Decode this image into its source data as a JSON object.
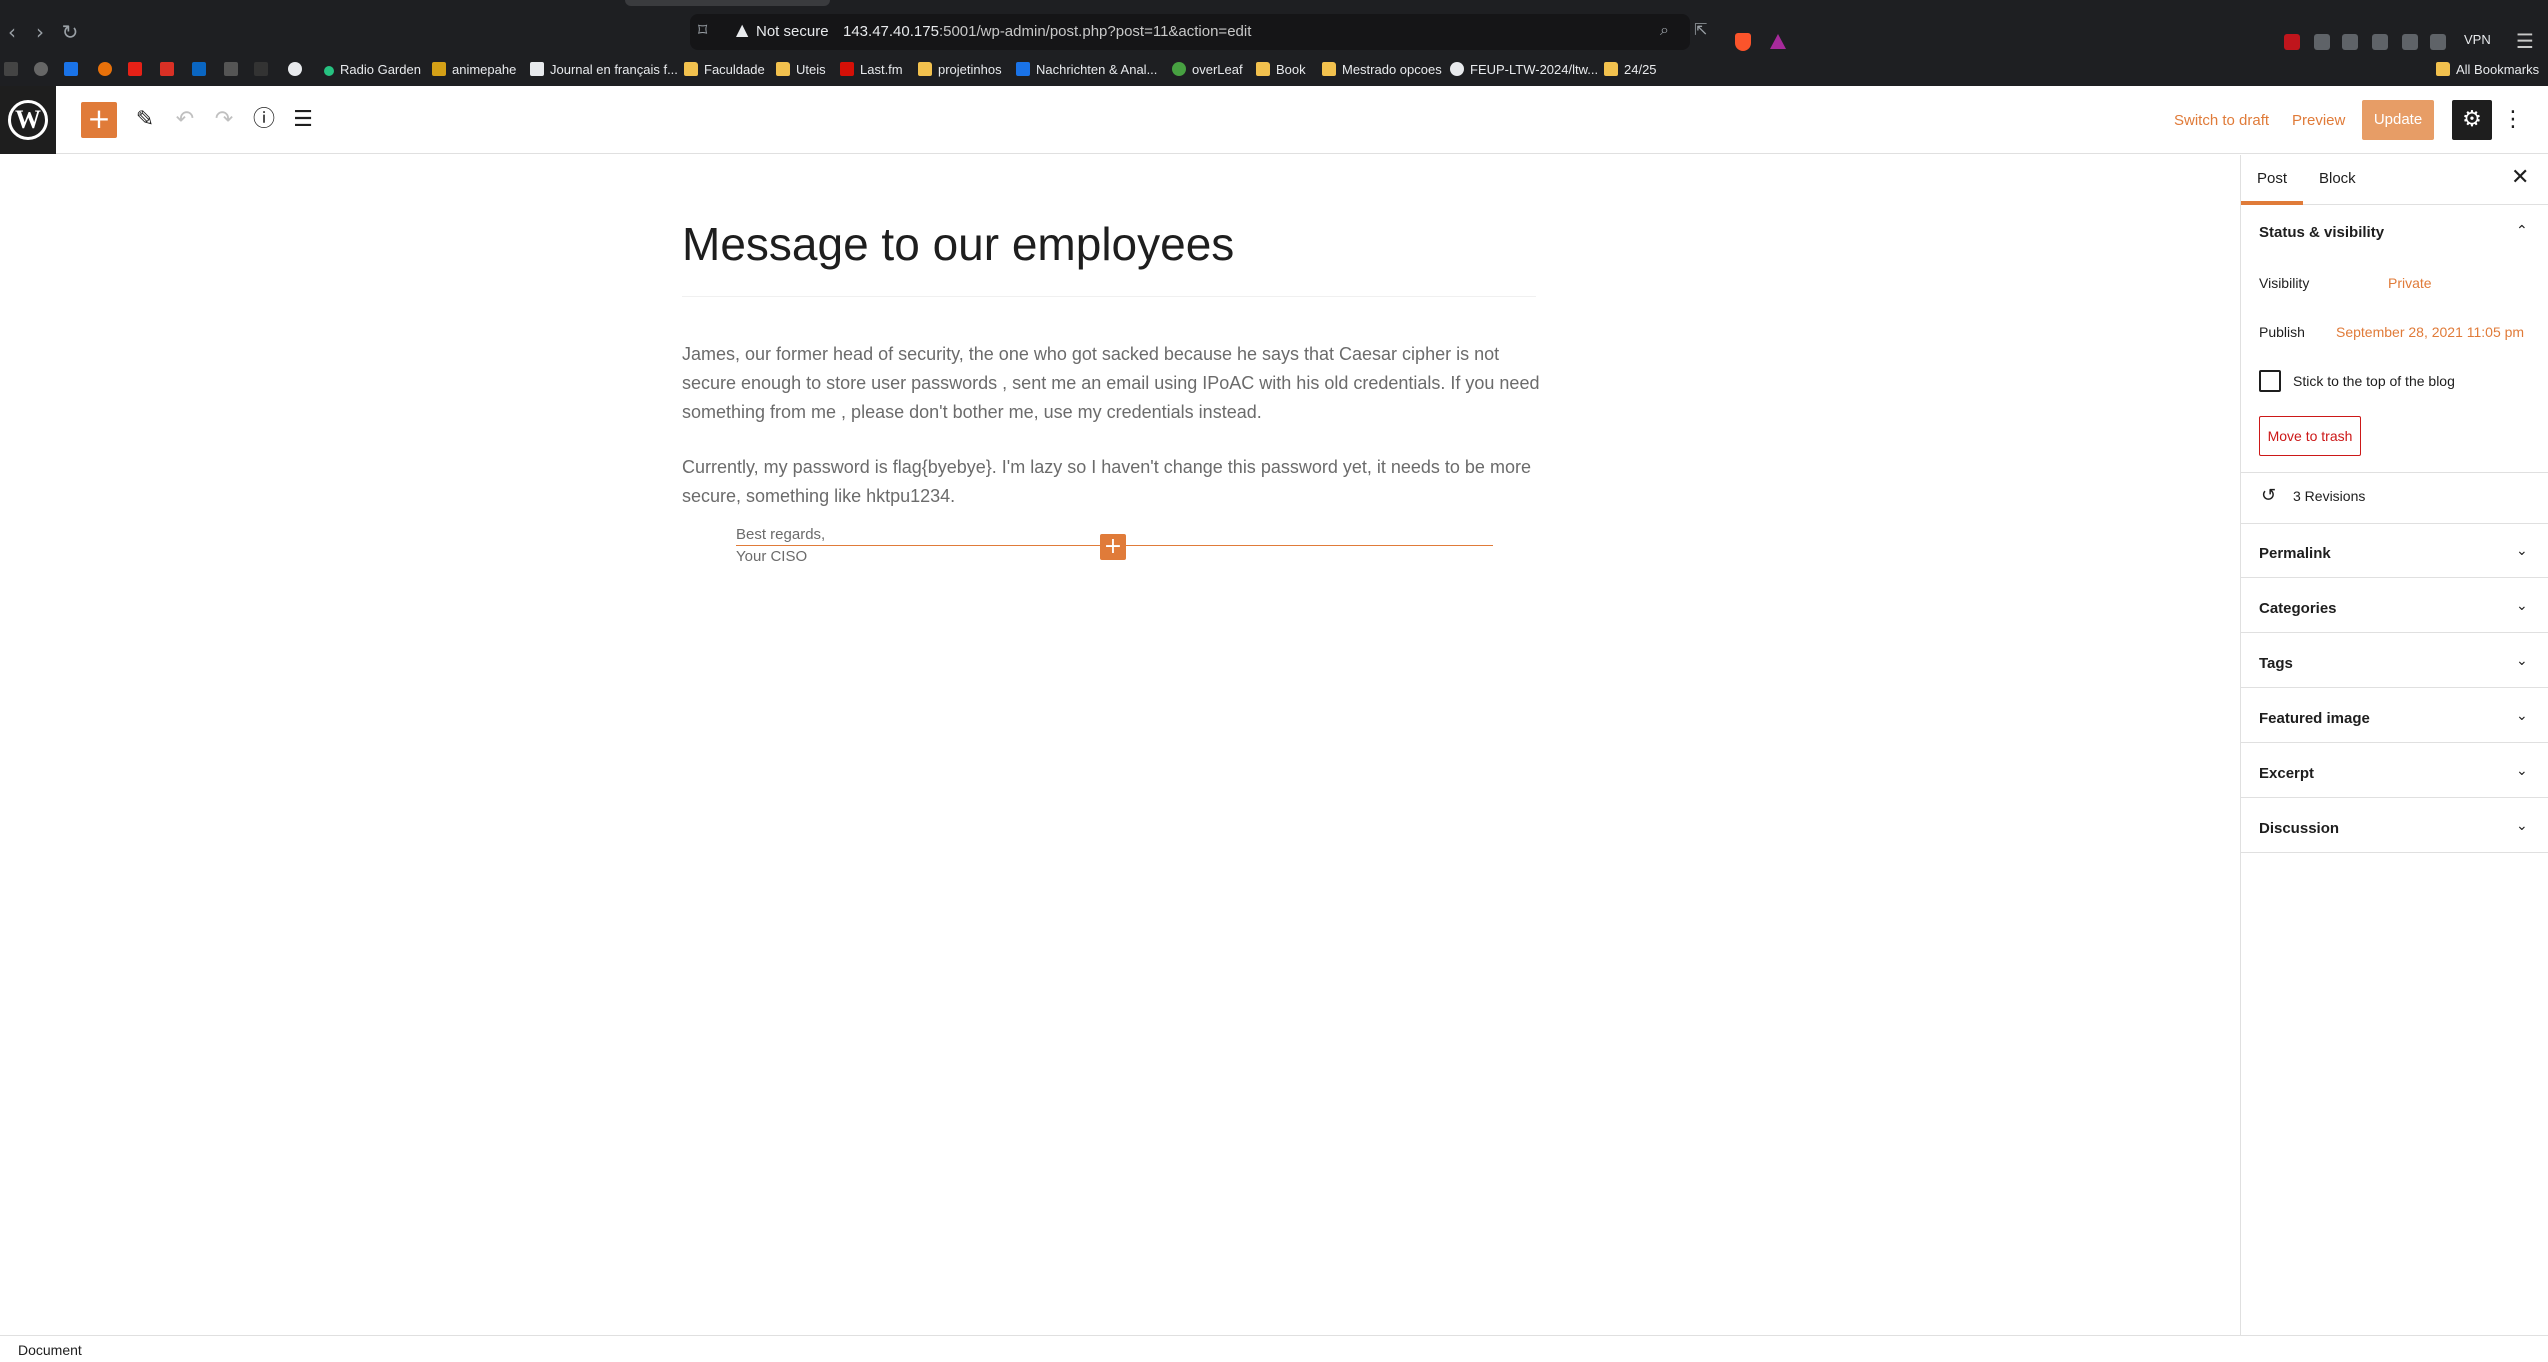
{
  "browser": {
    "security_label": "Not secure",
    "url_host": "143.47.40.175",
    "url_rest": ":5001/wp-admin/post.php?post=11&action=edit",
    "vpn_label": "VPN",
    "bookmarks": [
      "Radio Garden",
      "animepahe",
      "Journal en français f...",
      "Faculdade",
      "Uteis",
      "Last.fm",
      "projetinhos",
      "Nachrichten & Anal...",
      "overLeaf",
      "Book",
      "Mestrado opcoes",
      "FEUP-LTW-2024/ltw...",
      "24/25"
    ],
    "all_bookmarks": "All Bookmarks"
  },
  "toolbar": {
    "add_block": "+",
    "switch_to_draft": "Switch to draft",
    "preview": "Preview",
    "update": "Update"
  },
  "post": {
    "title": "Message to our employees",
    "paragraph1": "James, our former head of security, the one who got sacked because he says that Caesar cipher is not secure enough  to store user passwords , sent me an email using IPoAC with his old credentials. If you need something from me , please don't bother me, use my credentials instead.",
    "paragraph2": "Currently, my password is flag{byebye}. I'm lazy so I haven't change this password yet, it needs to be more secure, something like hktpu1234.",
    "signature_line1": "Best regards,",
    "signature_line2": "Your CISO"
  },
  "sidebar": {
    "tab_post": "Post",
    "tab_block": "Block",
    "status_visibility": "Status & visibility",
    "visibility_label": "Visibility",
    "visibility_value": "Private",
    "publish_label": "Publish",
    "publish_value": "September 28, 2021 11:05 pm",
    "stick_label": "Stick to the top of the blog",
    "move_to_trash": "Move to trash",
    "revisions": "3 Revisions",
    "panels": [
      "Permalink",
      "Categories",
      "Tags",
      "Featured image",
      "Excerpt",
      "Discussion"
    ]
  },
  "statusbar": {
    "breadcrumb": "Document"
  },
  "colors": {
    "accent": "#e07b39",
    "danger": "#cc1818",
    "chrome_dark": "#1e1f22"
  }
}
